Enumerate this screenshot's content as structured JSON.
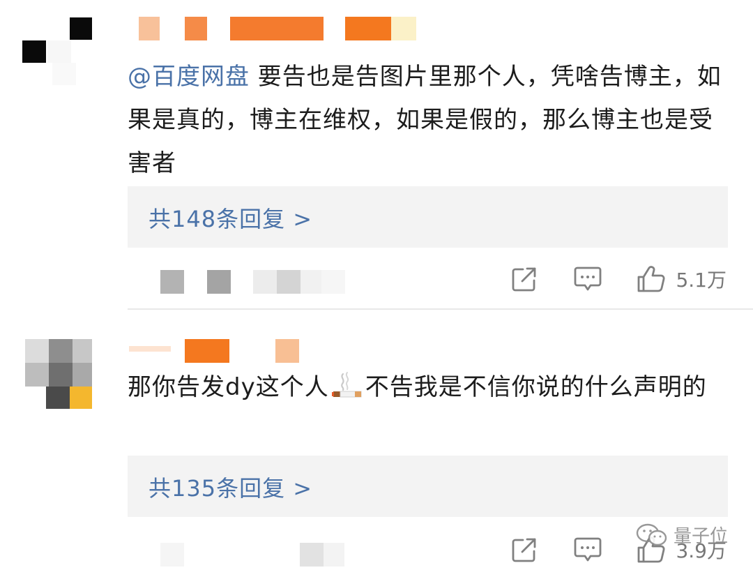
{
  "comments": [
    {
      "mention": "@百度网盘",
      "text": " 要告也是告图片里那个人，凭啥告博主，如果是真的，博主在维权，如果是假的，那么博主也是受害者",
      "replies_label": "共148条回复 >",
      "likes": "5.1万"
    },
    {
      "text_before": "那你告发dy这个人",
      "text_after": "不告我是不信你说的什么声明的",
      "replies_label": "共135条回复 >",
      "likes": "3.9万"
    }
  ],
  "icons": {
    "share": "share-icon",
    "reply": "comment-icon",
    "like": "thumbs-up-icon",
    "emoji": "cigarette-emoji"
  },
  "colors": {
    "link": "#4a72a8",
    "reply_bg": "#f3f3f3",
    "action_gray": "#777777",
    "name_orange": "#f47b2e"
  },
  "watermark": {
    "text": "量子位"
  }
}
